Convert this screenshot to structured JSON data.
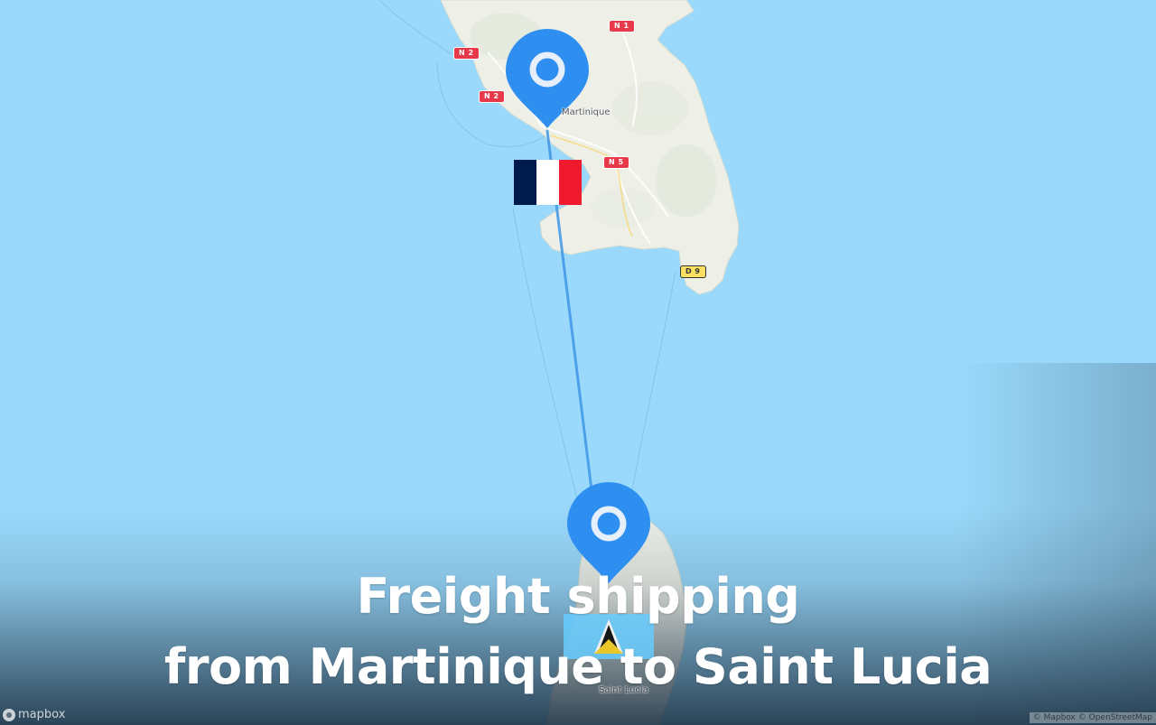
{
  "map": {
    "title_line1": "Freight shipping",
    "title_line2": "from Martinique to Saint Lucia",
    "colors": {
      "water": "#9ad9fb",
      "land": "#eef0e8",
      "route": "#3f95e6",
      "marker": "#2f8ff0"
    },
    "road_shields": [
      "N 1",
      "N 2",
      "N 2",
      "N 5",
      "D 9"
    ],
    "places": {
      "origin_label": "Martinique",
      "destination_label": "Saint Lucia"
    },
    "origin": {
      "name": "Martinique",
      "flag": "France",
      "flag_colors": [
        "#001a4d",
        "#ffffff",
        "#ef1a2d"
      ],
      "marker_icon": "map-pin-icon"
    },
    "destination": {
      "name": "Saint Lucia",
      "flag": "Saint Lucia",
      "flag_colors": [
        "#66ccff",
        "#fcd116",
        "#000000",
        "#ffffff"
      ],
      "marker_icon": "map-pin-icon"
    },
    "logo_text": "mapbox",
    "attribution_text": "© Mapbox © OpenStreetMap"
  }
}
